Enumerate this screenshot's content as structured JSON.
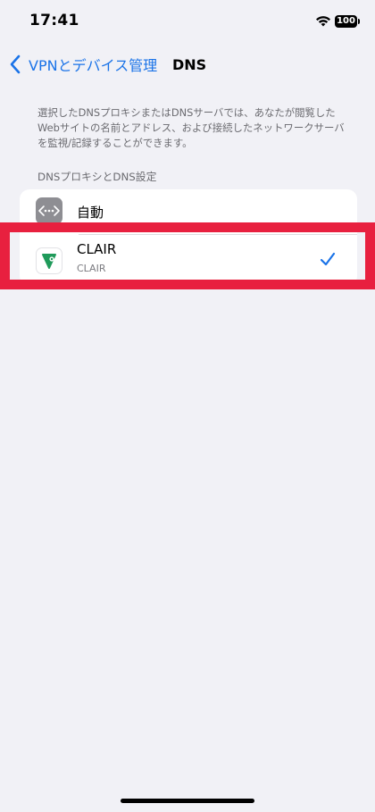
{
  "status_bar": {
    "time": "17:41",
    "battery": "100",
    "wifi_icon": "wifi-icon"
  },
  "nav": {
    "back_label": "VPNとデバイス管理",
    "back_icon": "chevron-left-icon",
    "title": "DNS"
  },
  "description": "選択したDNSプロキシまたはDNSサーバでは、あなたが閲覧したWebサイトの名前とアドレス、および接続したネットワークサーバを監視/記録することができます。",
  "section_header": "DNSプロキシとDNS設定",
  "options": [
    {
      "label": "自動",
      "subtitle": "",
      "icon": "network-dots-icon",
      "selected": false
    },
    {
      "label": "CLAIR",
      "subtitle": "CLAIR",
      "icon": "clair-app-icon",
      "selected": true
    }
  ],
  "colors": {
    "accent": "#1a73e8",
    "highlight": "#e8203f",
    "background": "#f1f1f6",
    "clair_green": "#1f9a5a"
  }
}
